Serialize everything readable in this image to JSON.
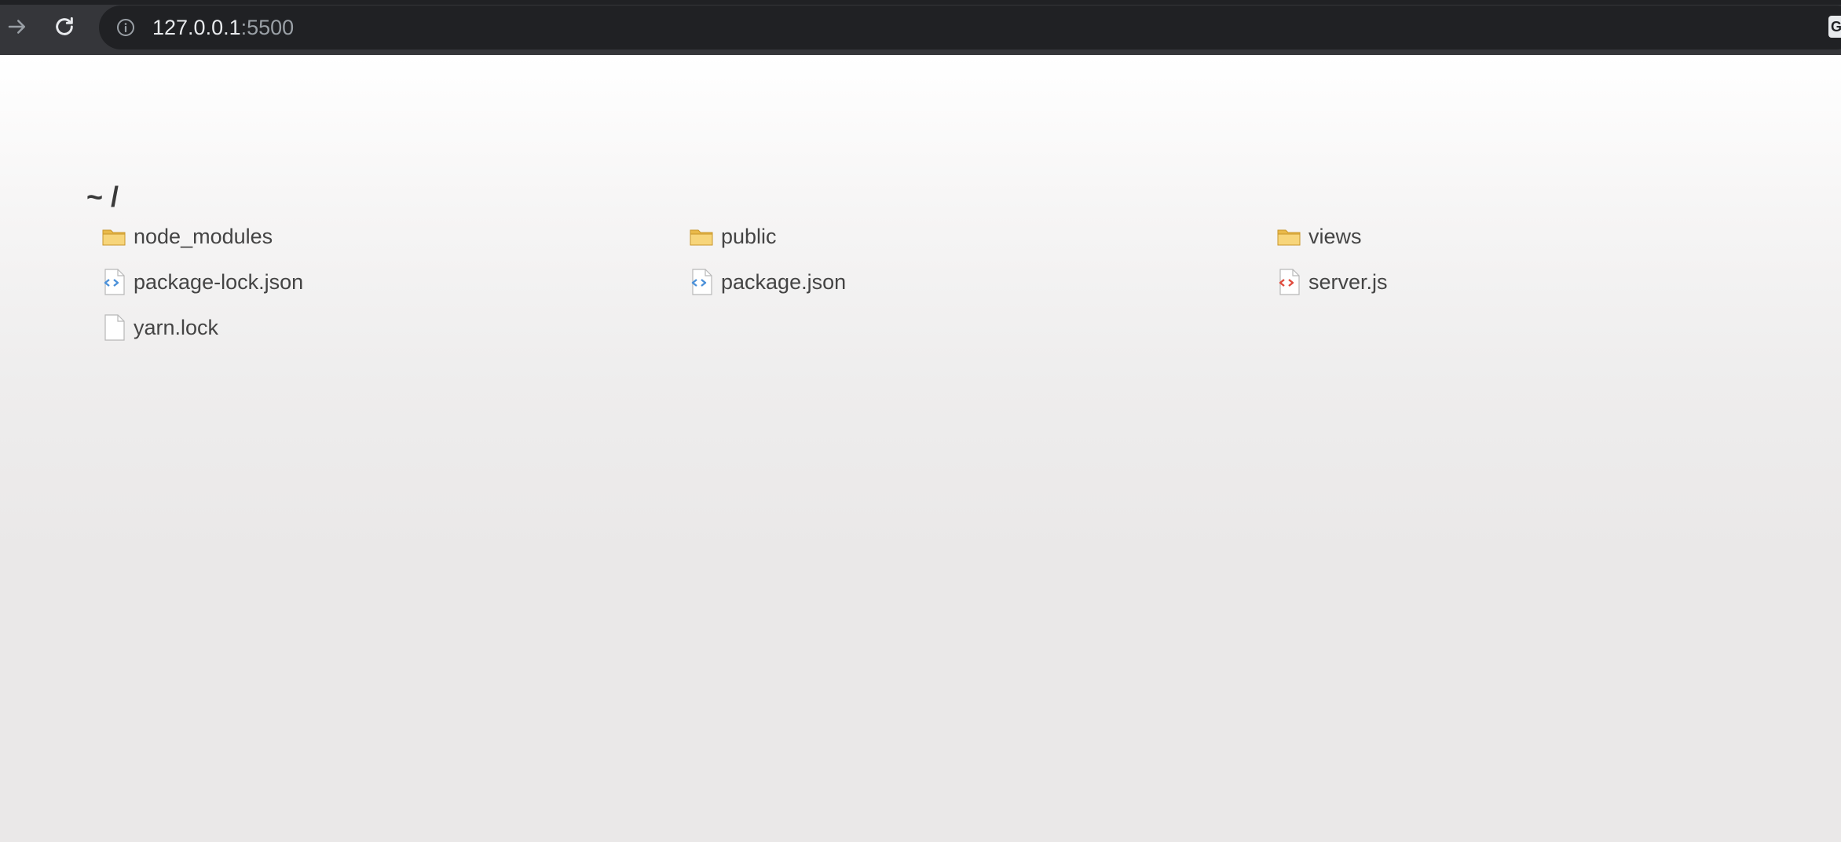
{
  "browser": {
    "url_host": "127.0.0.1",
    "url_port": ":5500",
    "extension_label": "G"
  },
  "page": {
    "breadcrumb": "~ /",
    "files": [
      {
        "name": "node_modules",
        "icon": "folder-icon"
      },
      {
        "name": "public",
        "icon": "folder-icon"
      },
      {
        "name": "views",
        "icon": "folder-icon"
      },
      {
        "name": "package-lock.json",
        "icon": "json-file-icon"
      },
      {
        "name": "package.json",
        "icon": "json-file-icon"
      },
      {
        "name": "server.js",
        "icon": "js-file-icon"
      },
      {
        "name": "yarn.lock",
        "icon": "blank-file-icon"
      }
    ]
  },
  "colors": {
    "folder": "#f4c95d",
    "json_accent": "#4a90d9",
    "js_accent": "#e04a3c"
  }
}
